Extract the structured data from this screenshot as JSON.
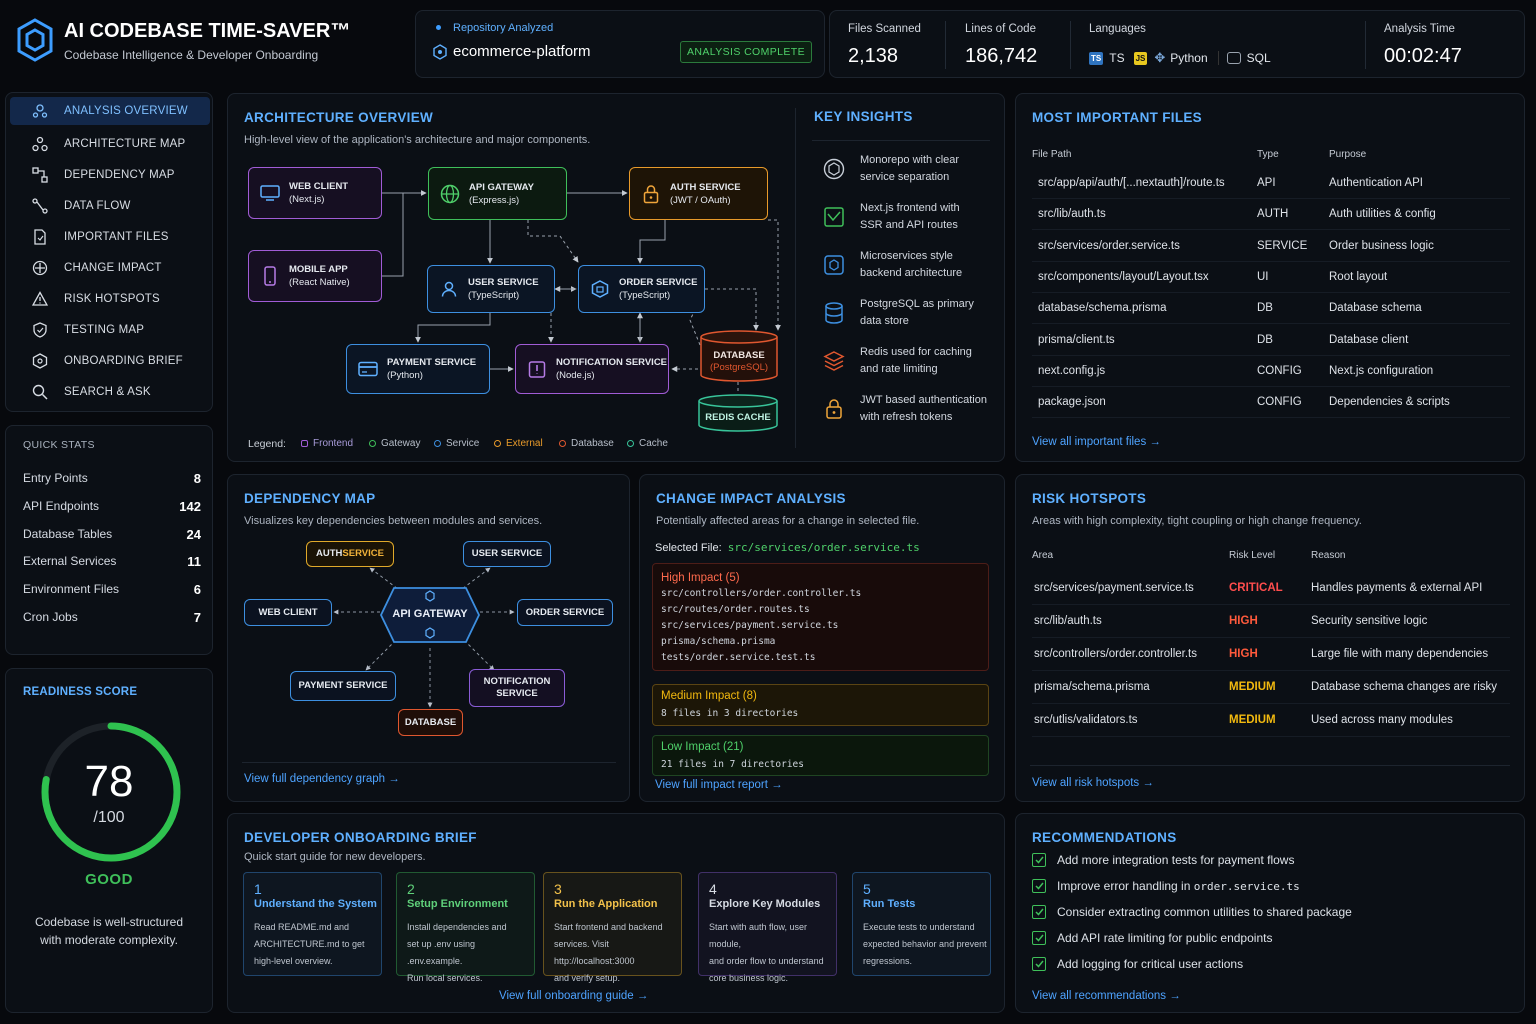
{
  "app": {
    "title": "AI CODEBASE TIME-SAVER™",
    "subtitle": "Codebase Intelligence & Developer Onboarding"
  },
  "repo": {
    "label": "Repository Analyzed",
    "name": "ecommerce-platform",
    "status": "ANALYSIS COMPLETE"
  },
  "stats": {
    "files_label": "Files Scanned",
    "files": "2,138",
    "loc_label": "Lines of Code",
    "loc": "186,742",
    "lang_label": "Languages",
    "lang_ts_badge": "TS",
    "lang_ts": "TS",
    "lang_js_badge": "JS",
    "lang_py": "Python",
    "lang_sql": "SQL",
    "time_label": "Analysis Time",
    "time": "00:02:47"
  },
  "nav": {
    "items": [
      {
        "label": "ANALYSIS OVERVIEW",
        "icon": "overview-icon"
      },
      {
        "label": "ARCHITECTURE MAP",
        "icon": "architecture-icon"
      },
      {
        "label": "DEPENDENCY MAP",
        "icon": "dependency-icon"
      },
      {
        "label": "DATA FLOW",
        "icon": "data-flow-icon"
      },
      {
        "label": "IMPORTANT FILES",
        "icon": "file-icon"
      },
      {
        "label": "CHANGE IMPACT",
        "icon": "target-icon"
      },
      {
        "label": "RISK HOTSPOTS",
        "icon": "warning-icon"
      },
      {
        "label": "TESTING MAP",
        "icon": "shield-icon"
      },
      {
        "label": "ONBOARDING BRIEF",
        "icon": "brief-icon"
      },
      {
        "label": "SEARCH & ASK",
        "icon": "search-icon"
      }
    ]
  },
  "quick_stats": {
    "title": "QUICK STATS",
    "rows": [
      {
        "label": "Entry Points",
        "value": "8"
      },
      {
        "label": "API Endpoints",
        "value": "142"
      },
      {
        "label": "Database Tables",
        "value": "24"
      },
      {
        "label": "External Services",
        "value": "11"
      },
      {
        "label": "Environment Files",
        "value": "6"
      },
      {
        "label": "Cron Jobs",
        "value": "7"
      }
    ]
  },
  "readiness": {
    "title": "READINESS SCORE",
    "score": "78",
    "max": "/100",
    "fraction": 0.78,
    "grade": "GOOD",
    "note_1": "Codebase is well-structured",
    "note_2": "with moderate complexity."
  },
  "architecture": {
    "title": "ARCHITECTURE OVERVIEW",
    "subtitle": "High-level view of the application's architecture and major components.",
    "nodes": {
      "web": {
        "name": "WEB CLIENT",
        "tech": "(Next.js)"
      },
      "mobile": {
        "name": "MOBILE APP",
        "tech": "(React Native)"
      },
      "gateway": {
        "name": "API GATEWAY",
        "tech": "(Express.js)"
      },
      "auth": {
        "name": "AUTH SERVICE",
        "tech": "(JWT / OAuth)"
      },
      "user": {
        "name": "USER SERVICE",
        "tech": "(TypeScript)"
      },
      "order": {
        "name": "ORDER SERVICE",
        "tech": "(TypeScript)"
      },
      "payment": {
        "name": "PAYMENT SERVICE",
        "tech": "(Python)"
      },
      "notif": {
        "name": "NOTIFICATION SERVICE",
        "tech": "(Node.js)"
      },
      "db": {
        "name": "DATABASE",
        "tech": "(PostgreSQL)"
      },
      "cache": {
        "name": "REDIS CACHE"
      }
    },
    "legend_label": "Legend:",
    "legend": [
      "Frontend",
      "Gateway",
      "Service",
      "External",
      "Database",
      "Cache"
    ],
    "colors": {
      "frontend": "#a15cd6",
      "gateway": "#3fbf5a",
      "service": "#3d8fe0",
      "external": "#e89a2a",
      "database": "#e0572f",
      "cache": "#38c49a"
    }
  },
  "insights": {
    "title": "KEY INSIGHTS",
    "items": [
      {
        "l1": "Monorepo with clear",
        "l2": "service separation",
        "icon": "package-icon"
      },
      {
        "l1": "Next.js frontend with",
        "l2": "SSR and API routes",
        "icon": "chart-icon"
      },
      {
        "l1": "Microservices style",
        "l2": "backend architecture",
        "icon": "cube-icon"
      },
      {
        "l1": "PostgreSQL as primary",
        "l2": "data store",
        "icon": "database-icon"
      },
      {
        "l1": "Redis used for caching",
        "l2": "and rate limiting",
        "icon": "stack-icon"
      },
      {
        "l1": "JWT based authentication",
        "l2": "with refresh tokens",
        "icon": "lock-icon"
      }
    ]
  },
  "important_files": {
    "title": "MOST IMPORTANT FILES",
    "headers": [
      "File Path",
      "Type",
      "Purpose"
    ],
    "rows": [
      {
        "path": "src/app/api/auth/[...nextauth]/route.ts",
        "type": "API",
        "purpose": "Authentication API"
      },
      {
        "path": "src/lib/auth.ts",
        "type": "AUTH",
        "purpose": "Auth utilities & config"
      },
      {
        "path": "src/services/order.service.ts",
        "type": "SERVICE",
        "purpose": "Order business logic"
      },
      {
        "path": "src/components/layout/Layout.tsx",
        "type": "UI",
        "purpose": "Root layout"
      },
      {
        "path": "database/schema.prisma",
        "type": "DB",
        "purpose": "Database schema"
      },
      {
        "path": "prisma/client.ts",
        "type": "DB",
        "purpose": "Database client"
      },
      {
        "path": "next.config.js",
        "type": "CONFIG",
        "purpose": "Next.js configuration"
      },
      {
        "path": "package.json",
        "type": "CONFIG",
        "purpose": "Dependencies & scripts"
      }
    ],
    "link": "View all important files →"
  },
  "dependency": {
    "title": "DEPENDENCY MAP",
    "subtitle": "Visualizes key dependencies between modules and services.",
    "nodes": {
      "auth_a": "AUTH ",
      "auth_b": "SERVICE",
      "user": "USER SERVICE",
      "web": "WEB CLIENT",
      "gateway": "API GATEWAY",
      "order": "ORDER SERVICE",
      "payment": "PAYMENT SERVICE",
      "notif_1": "NOTIFICATION",
      "notif_2": "SERVICE",
      "db": "DATABASE"
    },
    "link": "View full dependency graph →"
  },
  "impact": {
    "title": "CHANGE IMPACT ANALYSIS",
    "subtitle": "Potentially affected areas for a change in selected file.",
    "selected_label": "Selected File:",
    "selected_file": "src/services/order.service.ts",
    "high": {
      "label": "High Impact (5)",
      "files": [
        "src/controllers/order.controller.ts",
        "src/routes/order.routes.ts",
        "src/services/payment.service.ts",
        "prisma/schema.prisma",
        "tests/order.service.test.ts"
      ]
    },
    "medium": {
      "label": "Medium Impact (8)",
      "detail": "8 files in 3 directories"
    },
    "low": {
      "label": "Low Impact (21)",
      "detail": "21 files in 7 directories"
    },
    "link": "View full impact report →"
  },
  "risk": {
    "title": "RISK HOTSPOTS",
    "subtitle": "Areas with high complexity, tight coupling or high change frequency.",
    "headers": [
      "Area",
      "Risk Level",
      "Reason"
    ],
    "rows": [
      {
        "area": "src/services/payment.service.ts",
        "level": "CRITICAL",
        "reason": "Handles payments & external API",
        "color": "#ff4d4d"
      },
      {
        "area": "src/lib/auth.ts",
        "level": "HIGH",
        "reason": "Security sensitive logic",
        "color": "#ff5a3c"
      },
      {
        "area": "src/controllers/order.controller.ts",
        "level": "HIGH",
        "reason": "Large file with many dependencies",
        "color": "#ff5a3c"
      },
      {
        "area": "prisma/schema.prisma",
        "level": "MEDIUM",
        "reason": "Database schema changes are risky",
        "color": "#f2b90f"
      },
      {
        "area": "src/utlis/validators.ts",
        "level": "MEDIUM",
        "reason": "Used across many modules",
        "color": "#f2b90f"
      }
    ],
    "link": "View all risk hotspots →"
  },
  "onboarding": {
    "title": "DEVELOPER ONBOARDING BRIEF",
    "subtitle": "Quick start guide for new developers.",
    "steps": [
      {
        "n": "1",
        "title": "Understand the System",
        "d1": "Read README.md and",
        "d2": "ARCHITECTURE.md to get",
        "d3": "high-level overview.",
        "color": "#3d8fe0",
        "tcolor": "#5fb0ff"
      },
      {
        "n": "2",
        "title": "Setup Environment",
        "d1": "Install dependencies and",
        "d2": "set up .env using .env.example.",
        "d3": "Run local services.",
        "color": "#3fbf5a",
        "tcolor": "#5fd07a"
      },
      {
        "n": "3",
        "title": "Run the Application",
        "d1": "Start frontend and backend",
        "d2": "services. Visit http://localhost:3000",
        "d3": "and verify setup.",
        "color": "#e0a92a",
        "tcolor": "#f2c14a"
      },
      {
        "n": "4",
        "title": "Explore Key Modules",
        "d1": "Start with auth flow, user module,",
        "d2": "and order flow to understand",
        "d3": "core business logic.",
        "color": "#8a5cd6",
        "tcolor": "#d6dbe3"
      },
      {
        "n": "5",
        "title": "Run Tests",
        "d1": "Execute tests to understand",
        "d2": "expected behavior and prevent",
        "d3": "regressions.",
        "color": "#3d8fe0",
        "tcolor": "#5fb0ff"
      }
    ],
    "link": "View full onboarding guide →"
  },
  "recommendations": {
    "title": "RECOMMENDATIONS",
    "items": [
      {
        "text": "Add more integration tests for payment flows"
      },
      {
        "text": "Improve error handling in ",
        "code": "order.service.ts"
      },
      {
        "text": "Consider extracting common utilities to shared package"
      },
      {
        "text": "Add API rate limiting for public endpoints"
      },
      {
        "text": "Add logging for critical user actions"
      }
    ],
    "link": "View all recommendations →"
  }
}
